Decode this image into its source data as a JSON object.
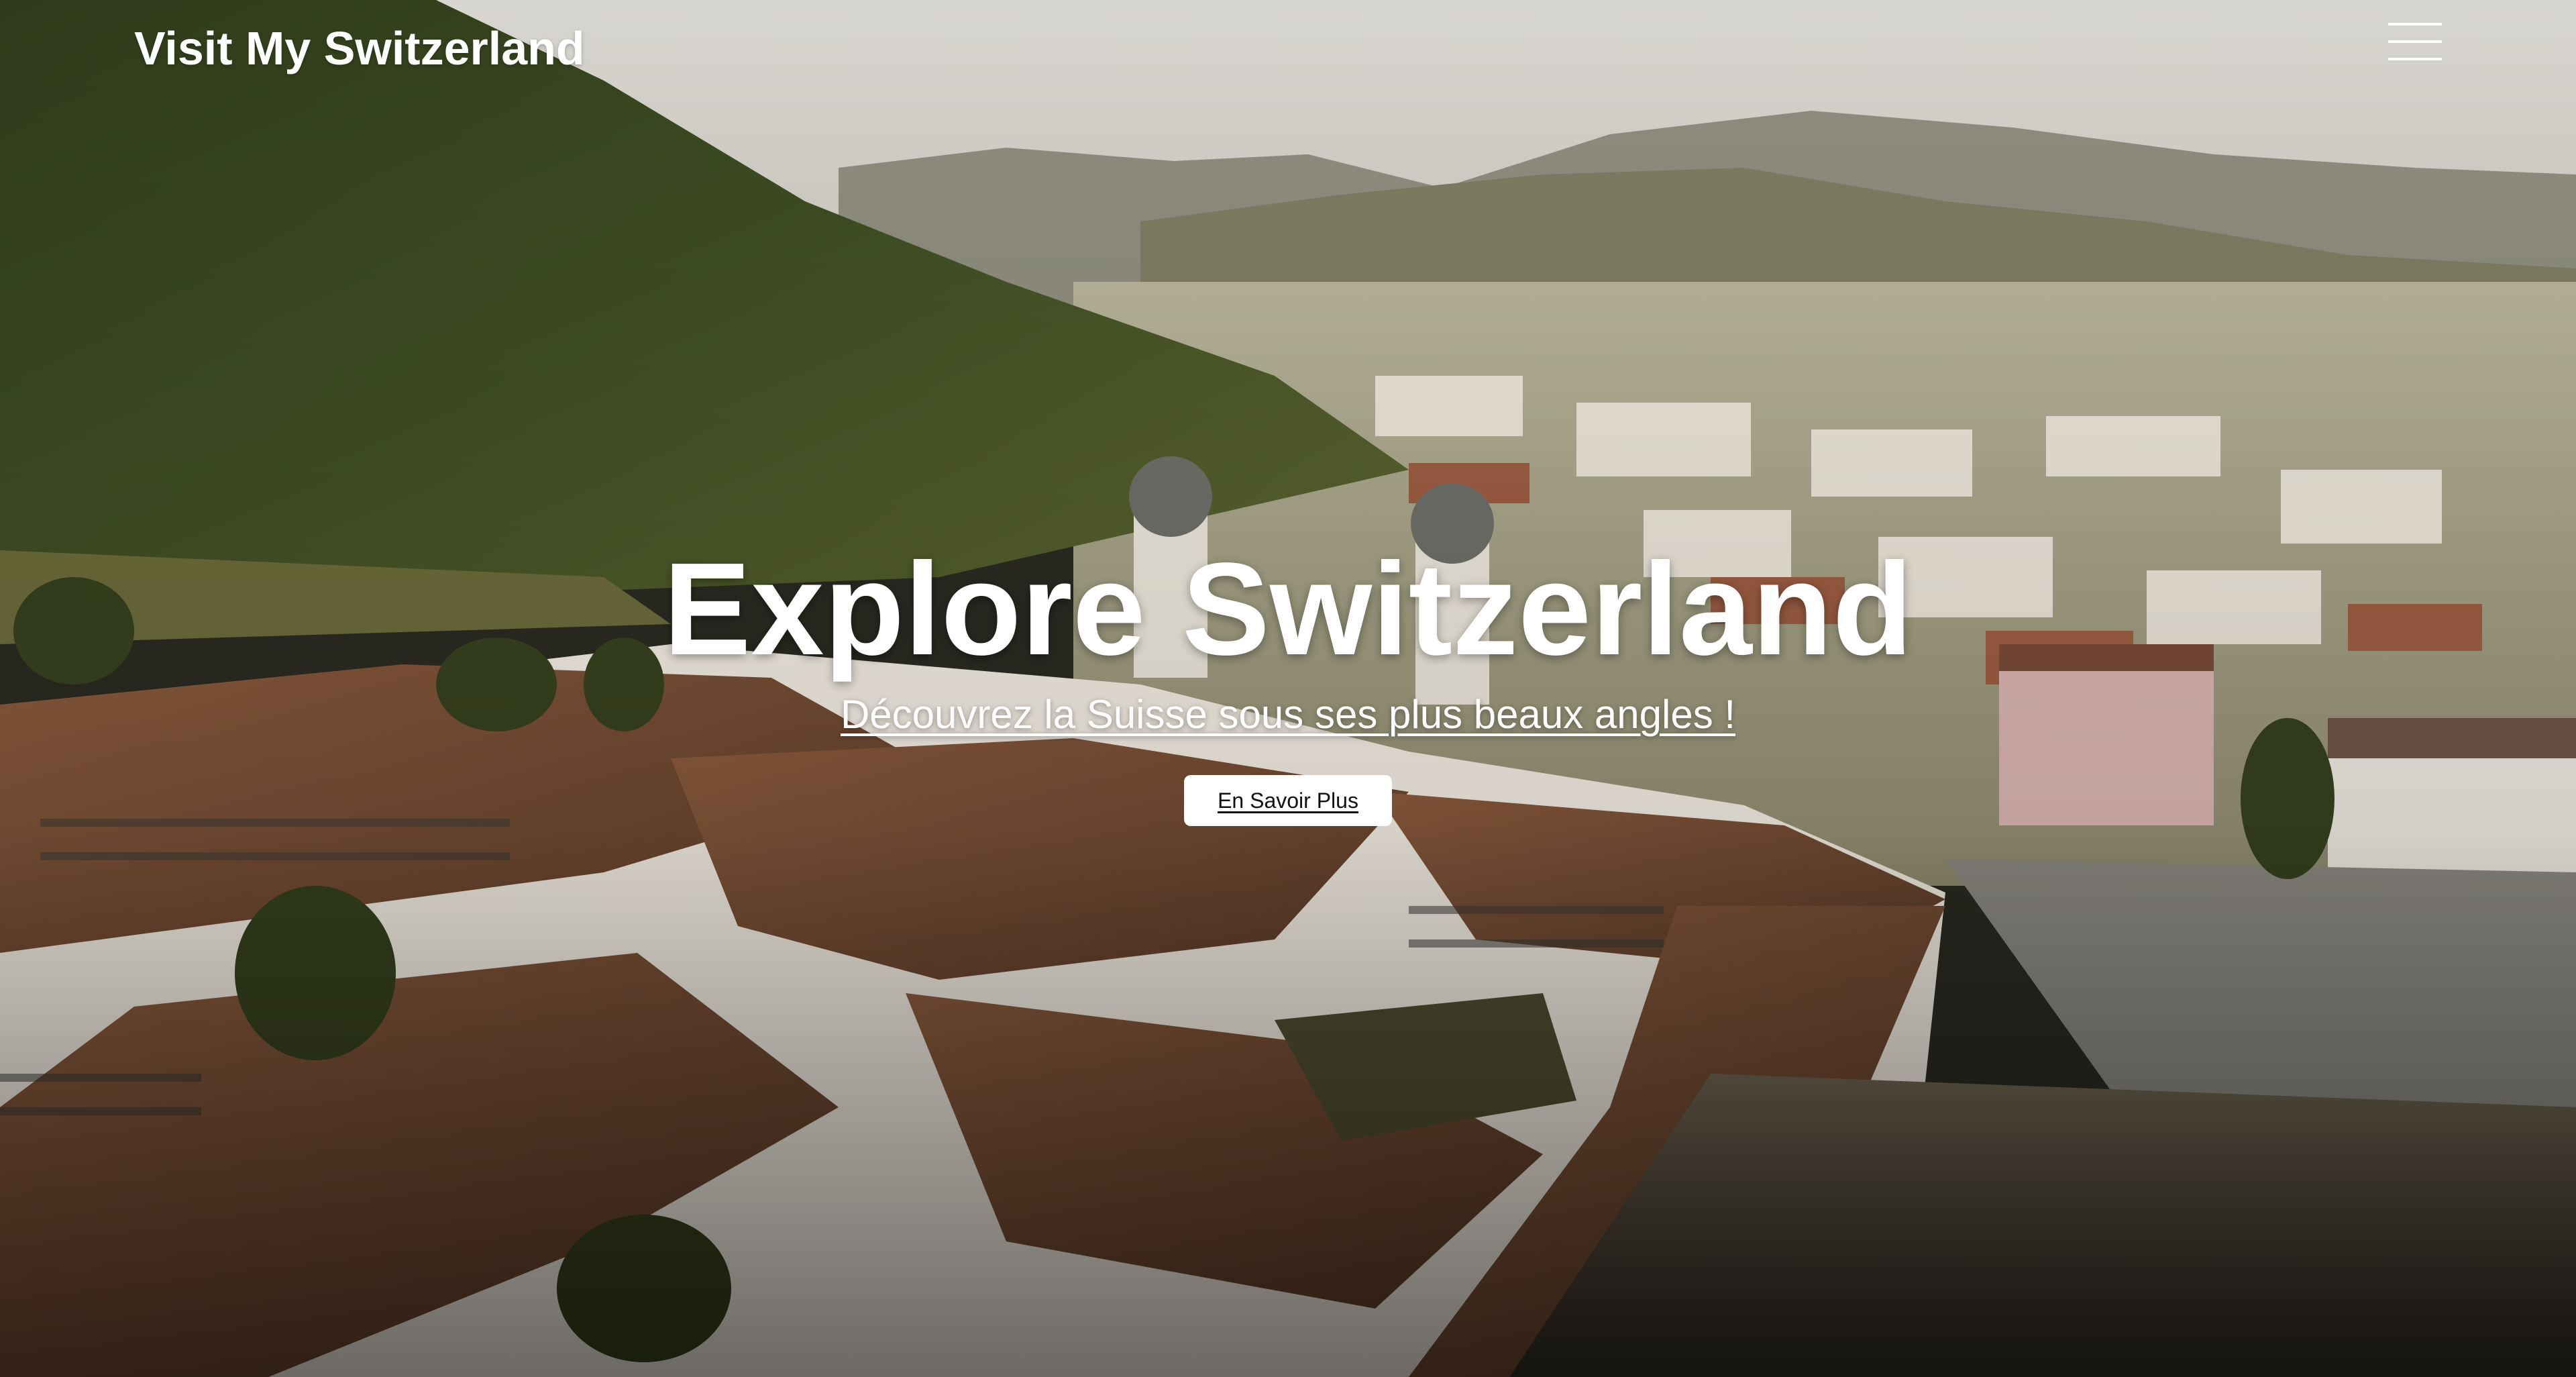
{
  "navbar": {
    "brand": "Visit My Switzerland",
    "menu_icon": "hamburger-menu-icon"
  },
  "hero": {
    "title": "Explore Switzerland",
    "subtitle": "Découvrez la Suisse sous ses plus beaux angles !",
    "cta_label": "En Savoir Plus",
    "background": "aerial-photo-abbey-town-mountains"
  },
  "colors": {
    "text": "#ffffff",
    "button_bg": "#ffffff",
    "button_text": "#111111"
  }
}
